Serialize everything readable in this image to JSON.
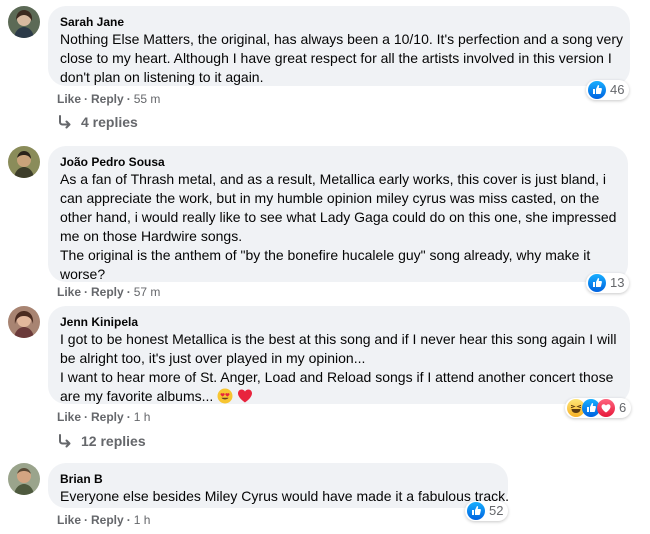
{
  "comments": [
    {
      "author": "Sarah Jane",
      "lines": [
        "Nothing Else Matters, the original, has always been a 10/10. It's perfection and a song very",
        "close to my heart. Although I have great respect for all the artists involved in this version I",
        "don't plan on listening to it again."
      ],
      "like_label": "Like",
      "reply_label": "Reply",
      "time": "55 m",
      "reaction_count": "46",
      "reactions": [
        "like-icon"
      ],
      "replies_label": "4 replies"
    },
    {
      "author": "João Pedro Sousa",
      "lines": [
        "As a fan of Thrash metal, and as a result, Metallica early works, this cover is just bland, i",
        "can appreciate the work, but in my humble opinion miley cyrus was miss casted, on the",
        "other hand, i would really like to see what Lady Gaga could do on this one, she impressed",
        "me on those Hardwire songs.",
        "The original is the anthem of \"by the bonefire hucalele guy\" song already, why make it",
        "worse?"
      ],
      "like_label": "Like",
      "reply_label": "Reply",
      "time": "57 m",
      "reaction_count": "13",
      "reactions": [
        "like-icon"
      ]
    },
    {
      "author": "Jenn Kinipela",
      "lines": [
        "I got to be honest Metallica is the best at this song and if I never hear this song again I will",
        "be alright too, it's just over played in my opinion...",
        "I want to hear more of St. Anger, Load and Reload songs if I attend another concert those",
        "are my favorite albums..."
      ],
      "line_emojis": [
        "heart-eyes-emoji",
        "red-heart-emoji"
      ],
      "like_label": "Like",
      "reply_label": "Reply",
      "time": "1 h",
      "reaction_count": "6",
      "reactions": [
        "haha-icon",
        "like-icon",
        "love-icon"
      ],
      "replies_label": "12 replies"
    },
    {
      "author": "Brian B",
      "lines": [
        "Everyone else besides Miley Cyrus would have made it a fabulous track."
      ],
      "like_label": "Like",
      "reply_label": "Reply",
      "time": "1 h",
      "reaction_count": "52",
      "reactions": [
        "like-icon"
      ]
    }
  ],
  "colors": {
    "bubble": "#f0f2f5",
    "meta_text": "#65676b",
    "like_blue": "#1877f2",
    "love_red": "#f33e58",
    "haha_yellow": "#f7b125"
  }
}
